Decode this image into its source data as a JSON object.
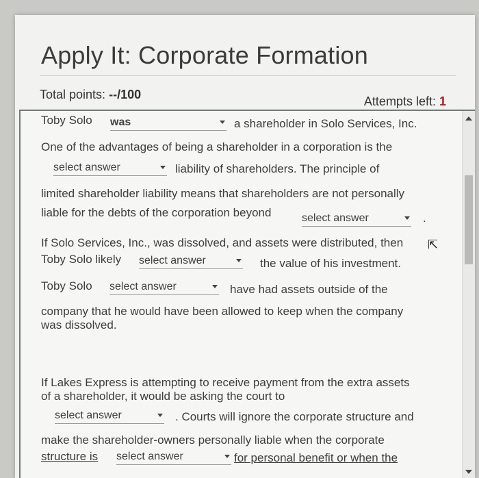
{
  "header": {
    "title": "Apply It: Corporate Formation",
    "total_points_label": "Total points:",
    "total_points_value": "--/100",
    "attempts_label": "Attempts left:",
    "attempts_value": "1"
  },
  "question": {
    "p1_before": "Toby Solo",
    "dd1": "was",
    "p1_after": "a shareholder in Solo Services, Inc.",
    "p2_line1": "One of the advantages of being a shareholder in a corporation is the",
    "dd2": "select answer",
    "p2_after": "liability of shareholders. The principle of",
    "p3_line1": "limited shareholder liability means that shareholders are not personally",
    "p3_line2": "liable for the debts of the corporation beyond",
    "dd3": "select answer",
    "p3_end": ".",
    "p4_line1": "If Solo Services, Inc., was dissolved, and assets were distributed, then",
    "p4_before": "Toby Solo likely",
    "dd4": "select answer",
    "p4_after": "the value of his investment.",
    "p5_before": "Toby Solo",
    "dd5": "select answer",
    "p5_after": "have had assets outside of the",
    "p5_line2": "company that he would have been allowed to keep when the company",
    "p5_line3": "was dissolved.",
    "p6_line1": "If Lakes Express is attempting to receive payment from the extra assets",
    "p6_line2": "of a shareholder, it would be asking the court to",
    "dd6": "select answer",
    "p6_after": ". Courts will ignore the corporate structure and",
    "p6_line4": "make the shareholder-owners personally liable when the corporate",
    "p6_line5_before": "structure is",
    "dd7": "select answer",
    "p6_line5_after": "for personal benefit or when the"
  },
  "colors": {
    "attempts_accent": "#b01a1a"
  }
}
